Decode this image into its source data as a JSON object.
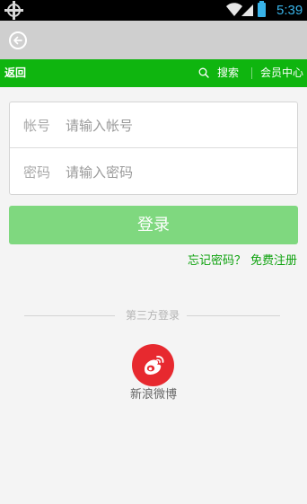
{
  "status_bar": {
    "time": "5:39"
  },
  "nav": {
    "back_label": "返回",
    "search_label": "搜索",
    "member_center_label": "会员中心"
  },
  "login_form": {
    "account_label": "帐号",
    "account_placeholder": "请输入帐号",
    "account_value": "",
    "password_label": "密码",
    "password_placeholder": "请输入密码",
    "password_value": "",
    "submit_label": "登录"
  },
  "links": {
    "forgot_password": "忘记密码？",
    "register": "免费注册"
  },
  "third_party": {
    "title": "第三方登录",
    "providers": [
      {
        "label": "新浪微博",
        "icon": "weibo-icon",
        "color": "#e7292f"
      }
    ]
  },
  "colors": {
    "nav_green": "#0fb50f",
    "button_green": "#7fd87f",
    "link_green": "#0ea20e",
    "status_blue": "#38b3e8"
  }
}
